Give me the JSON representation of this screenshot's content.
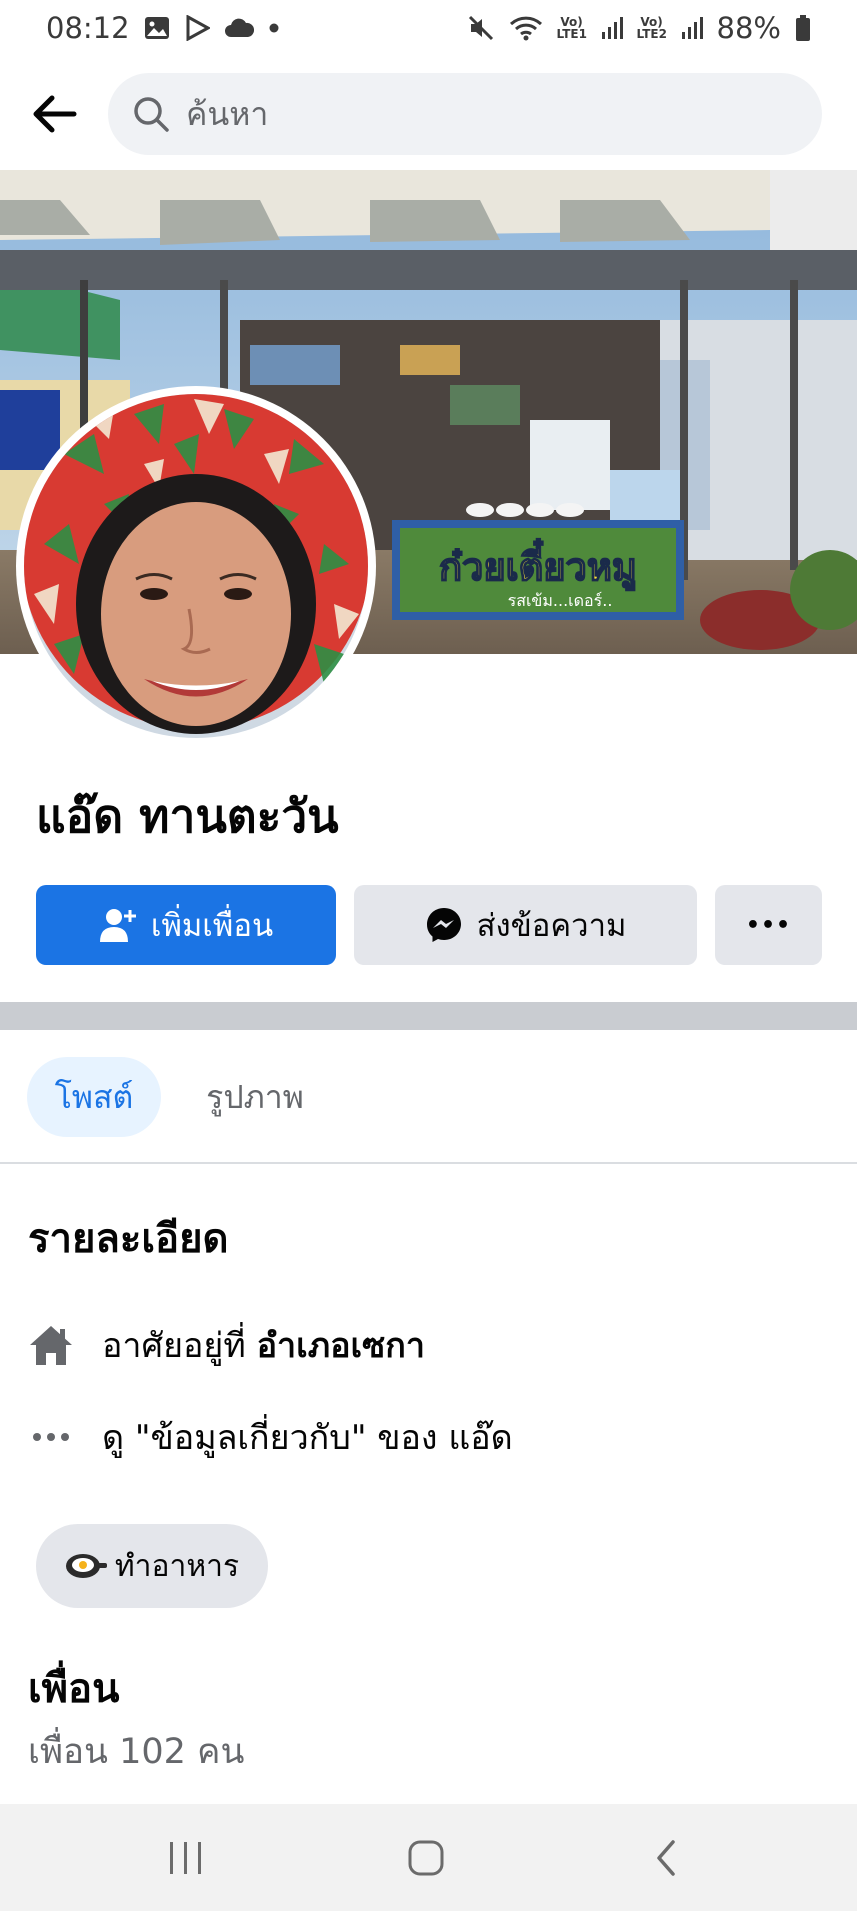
{
  "status_bar": {
    "time": "08:12",
    "battery": "88%",
    "sim1_label": "Vo) LTE1",
    "sim2_label": "Vo) LTE2",
    "icons": [
      "image-icon",
      "play-store-icon",
      "cloud-icon",
      "dot-icon",
      "mute-icon",
      "wifi-icon",
      "signal-icon",
      "battery-icon"
    ]
  },
  "header": {
    "search_placeholder": "ค้นหา"
  },
  "profile": {
    "name": "แอ๊ด ทานตะวัน"
  },
  "actions": {
    "add_friend_label": "เพิ่มเพื่อน",
    "message_label": "ส่งข้อความ",
    "more_label": "•••"
  },
  "tabs": [
    {
      "label": "โพสต์",
      "active": true
    },
    {
      "label": "รูปภาพ",
      "active": false
    }
  ],
  "details": {
    "title": "รายละเอียด",
    "lives_prefix": "อาศัยอยู่ที่ ",
    "lives_place": "อำเภอเซกา",
    "about_link": "ดู \"ข้อมูลเกี่ยวกับ\" ของ แอ๊ด",
    "hobby": "ทำอาหาร"
  },
  "friends": {
    "title": "เพื่อน",
    "count_text": "เพื่อน 102 คน"
  },
  "cover_text": {
    "sign": "ก๋วยเตี๋ยวหมู",
    "sign_sub": "รสเข้ม...เดอร์.."
  },
  "colors": {
    "primary": "#1b74e4",
    "button_gray": "#e4e6eb",
    "search_bg": "#f0f2f5",
    "tab_active_bg": "#e7f3ff",
    "secondary_text": "#65676b"
  }
}
